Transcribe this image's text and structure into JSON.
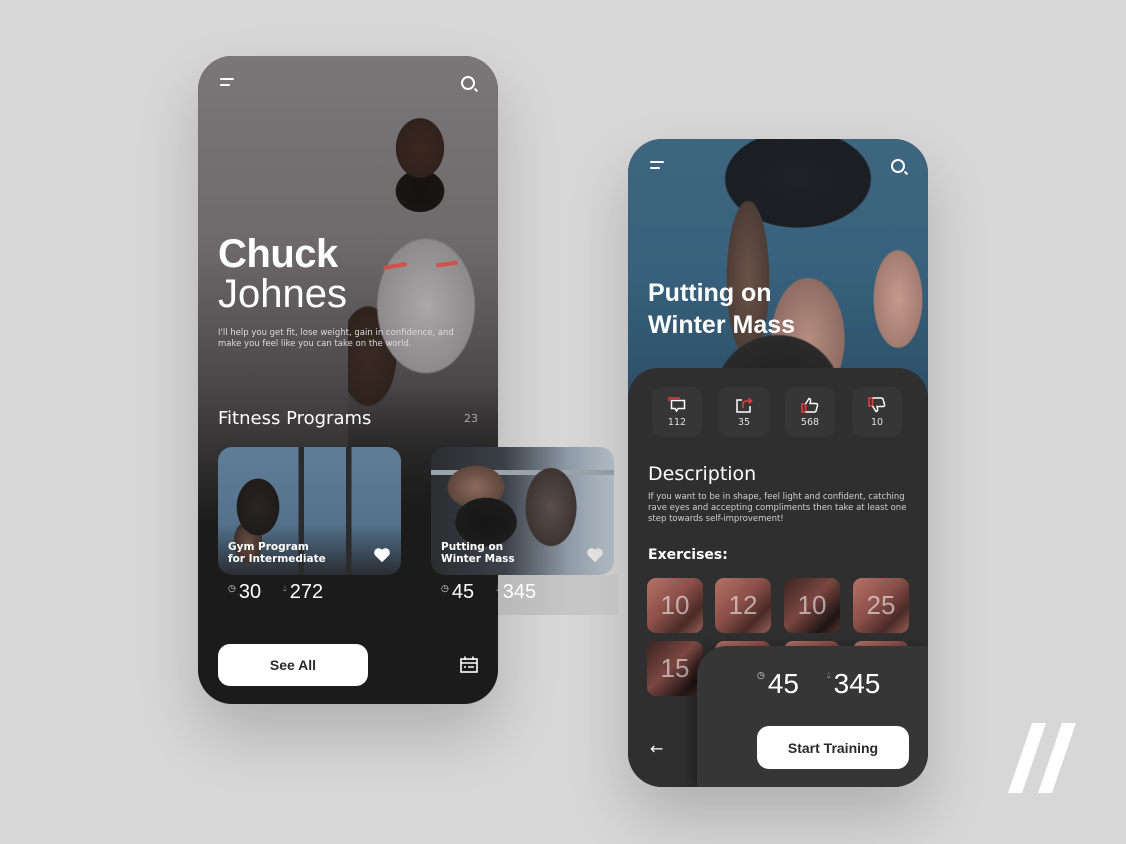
{
  "profile_screen": {
    "trainer_first_name": "Chuck",
    "trainer_last_name": "Johnes",
    "tagline": "I'll help you get fit, lose weight, gain in confidence, and make you feel like you can take on the world.",
    "section_title": "Fitness Programs",
    "program_count": "23",
    "programs": [
      {
        "title_line1": "Gym Program",
        "title_line2": "for Intermediate",
        "duration": "30",
        "calories": "272"
      },
      {
        "title_line1": "Putting on",
        "title_line2": "Winter Mass",
        "duration": "45",
        "calories": "345"
      }
    ],
    "see_all_label": "See All"
  },
  "program_screen": {
    "title_line1": "Putting on",
    "title_line2": "Winter Mass",
    "metrics": [
      {
        "icon": "comment-icon",
        "value": "112"
      },
      {
        "icon": "share-icon",
        "value": "35"
      },
      {
        "icon": "thumbs-up-icon",
        "value": "568"
      },
      {
        "icon": "thumbs-down-icon",
        "value": "10"
      }
    ],
    "description_title": "Description",
    "description": "If you want to be in shape, feel light and confident, catching rave eyes and accepting compliments then take at least one step towards self-improvement!",
    "exercises_title": "Exercises:",
    "exercises": [
      "10",
      "12",
      "10",
      "25",
      "15"
    ],
    "duration": "45",
    "calories": "345",
    "start_label": "Start Training"
  },
  "colors": {
    "accent_red": "#e23c3c",
    "background": "#d7d7d7",
    "phone1_bg": "#1b1b1b",
    "phone2_bg": "#2f2f2f"
  }
}
